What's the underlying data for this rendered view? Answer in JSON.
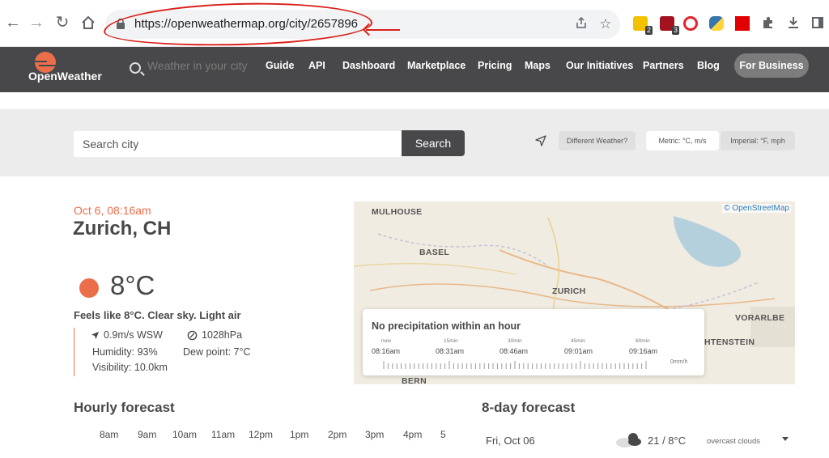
{
  "browser": {
    "url": "https://openweathermap.org/city/2657896",
    "extensions": [
      {
        "name": "extension-ext1",
        "color": "#f2c200",
        "badge": "2"
      },
      {
        "name": "extension-ext2",
        "color": "#a3121f",
        "badge": "3"
      },
      {
        "name": "extension-ext3",
        "color": "#e0242b",
        "badge": ""
      },
      {
        "name": "extension-ext4",
        "color": "#3776ab",
        "badge": ""
      },
      {
        "name": "extension-ext5",
        "color": "#e00000",
        "badge": ""
      }
    ]
  },
  "header": {
    "logo_text": "OpenWeather",
    "search_placeholder": "Weather in your city",
    "nav": [
      "Guide",
      "API",
      "Dashboard",
      "Marketplace",
      "Pricing",
      "Maps",
      "Our Initiatives",
      "Partners",
      "Blog"
    ],
    "business_button": "For Business"
  },
  "search": {
    "placeholder": "Search city",
    "button": "Search",
    "different_weather": "Different Weather?",
    "metric": "Metric: °C, m/s",
    "imperial": "Imperial: °F, mph"
  },
  "current": {
    "datetime": "Oct 6, 08:16am",
    "city": "Zurich, CH",
    "temperature": "8°C",
    "summary": "Feels like 8°C. Clear sky. Light air",
    "wind": "0.9m/s WSW",
    "pressure": "1028hPa",
    "humidity": "Humidity: 93%",
    "dew_point": "Dew point: 7°C",
    "visibility": "Visibility: 10.0km"
  },
  "map": {
    "credit": "© OpenStreetMap",
    "labels": [
      "MULHOUSE",
      "BASEL",
      "ZURICH",
      "VORARLBE",
      "HTENSTEIN",
      "BERN"
    ],
    "precipitation": {
      "title": "No precipitation within an hour",
      "offsets": [
        "now",
        "15min",
        "30min",
        "45min",
        "60min"
      ],
      "times": [
        "08:16am",
        "08:31am",
        "08:46am",
        "09:01am",
        "09:16am"
      ],
      "unit": "0mm/h"
    }
  },
  "hourly": {
    "title": "Hourly forecast",
    "hours": [
      "8am",
      "9am",
      "10am",
      "11am",
      "12pm",
      "1pm",
      "2pm",
      "3pm",
      "4pm",
      "5"
    ]
  },
  "daily": {
    "title": "8-day forecast",
    "rows": [
      {
        "date": "Fri, Oct 06",
        "temps": "21 / 8°C",
        "desc": "overcast clouds"
      }
    ]
  },
  "colors": {
    "accent": "#eb6e4b",
    "header_bg": "#48484a",
    "annotation": "#d9201a"
  }
}
